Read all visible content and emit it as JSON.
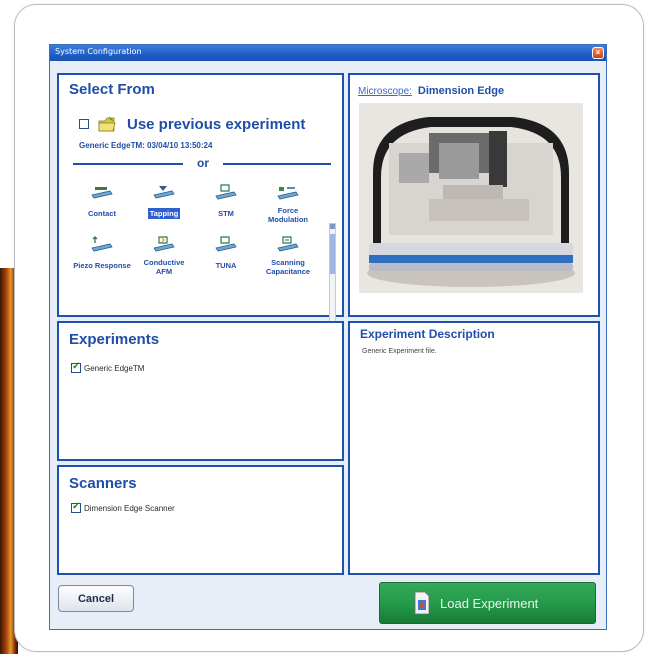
{
  "window": {
    "title": "System Configuration"
  },
  "select_from": {
    "title": "Select From",
    "use_previous": {
      "label": "Use previous experiment",
      "checked": false
    },
    "previous_info": "Generic EdgeTM: 03/04/10 13:50:24",
    "or_label": "or",
    "modes": [
      {
        "label": "Contact",
        "icon": "contact-mode-icon",
        "selected": false
      },
      {
        "label": "Tapping",
        "icon": "tapping-mode-icon",
        "selected": true
      },
      {
        "label": "STM",
        "icon": "stm-mode-icon",
        "selected": false
      },
      {
        "label": "Force Modulation",
        "icon": "force-modulation-icon",
        "selected": false
      },
      {
        "label": "Piezo Response",
        "icon": "piezo-response-icon",
        "selected": false
      },
      {
        "label": "Conductive AFM",
        "icon": "conductive-afm-icon",
        "selected": false
      },
      {
        "label": "TUNA",
        "icon": "tuna-mode-icon",
        "selected": false
      },
      {
        "label": "Scanning Capacitance",
        "icon": "scanning-capacitance-icon",
        "selected": false
      }
    ]
  },
  "microscope": {
    "link_label": "Microscope:",
    "name": "Dimension Edge"
  },
  "experiments": {
    "title": "Experiments",
    "items": [
      {
        "label": "Generic EdgeTM",
        "checked": true
      }
    ]
  },
  "scanners": {
    "title": "Scanners",
    "items": [
      {
        "label": "Dimension Edge Scanner",
        "checked": true
      }
    ]
  },
  "description": {
    "title": "Experiment Description",
    "text": "Generic Experiment file."
  },
  "buttons": {
    "cancel": "Cancel",
    "load": "Load Experiment"
  },
  "colors": {
    "accent": "#1f4ea8",
    "titlebar": "#1f5ec6",
    "load_button": "#229a48",
    "selected_mode": "#2f5fd0"
  }
}
